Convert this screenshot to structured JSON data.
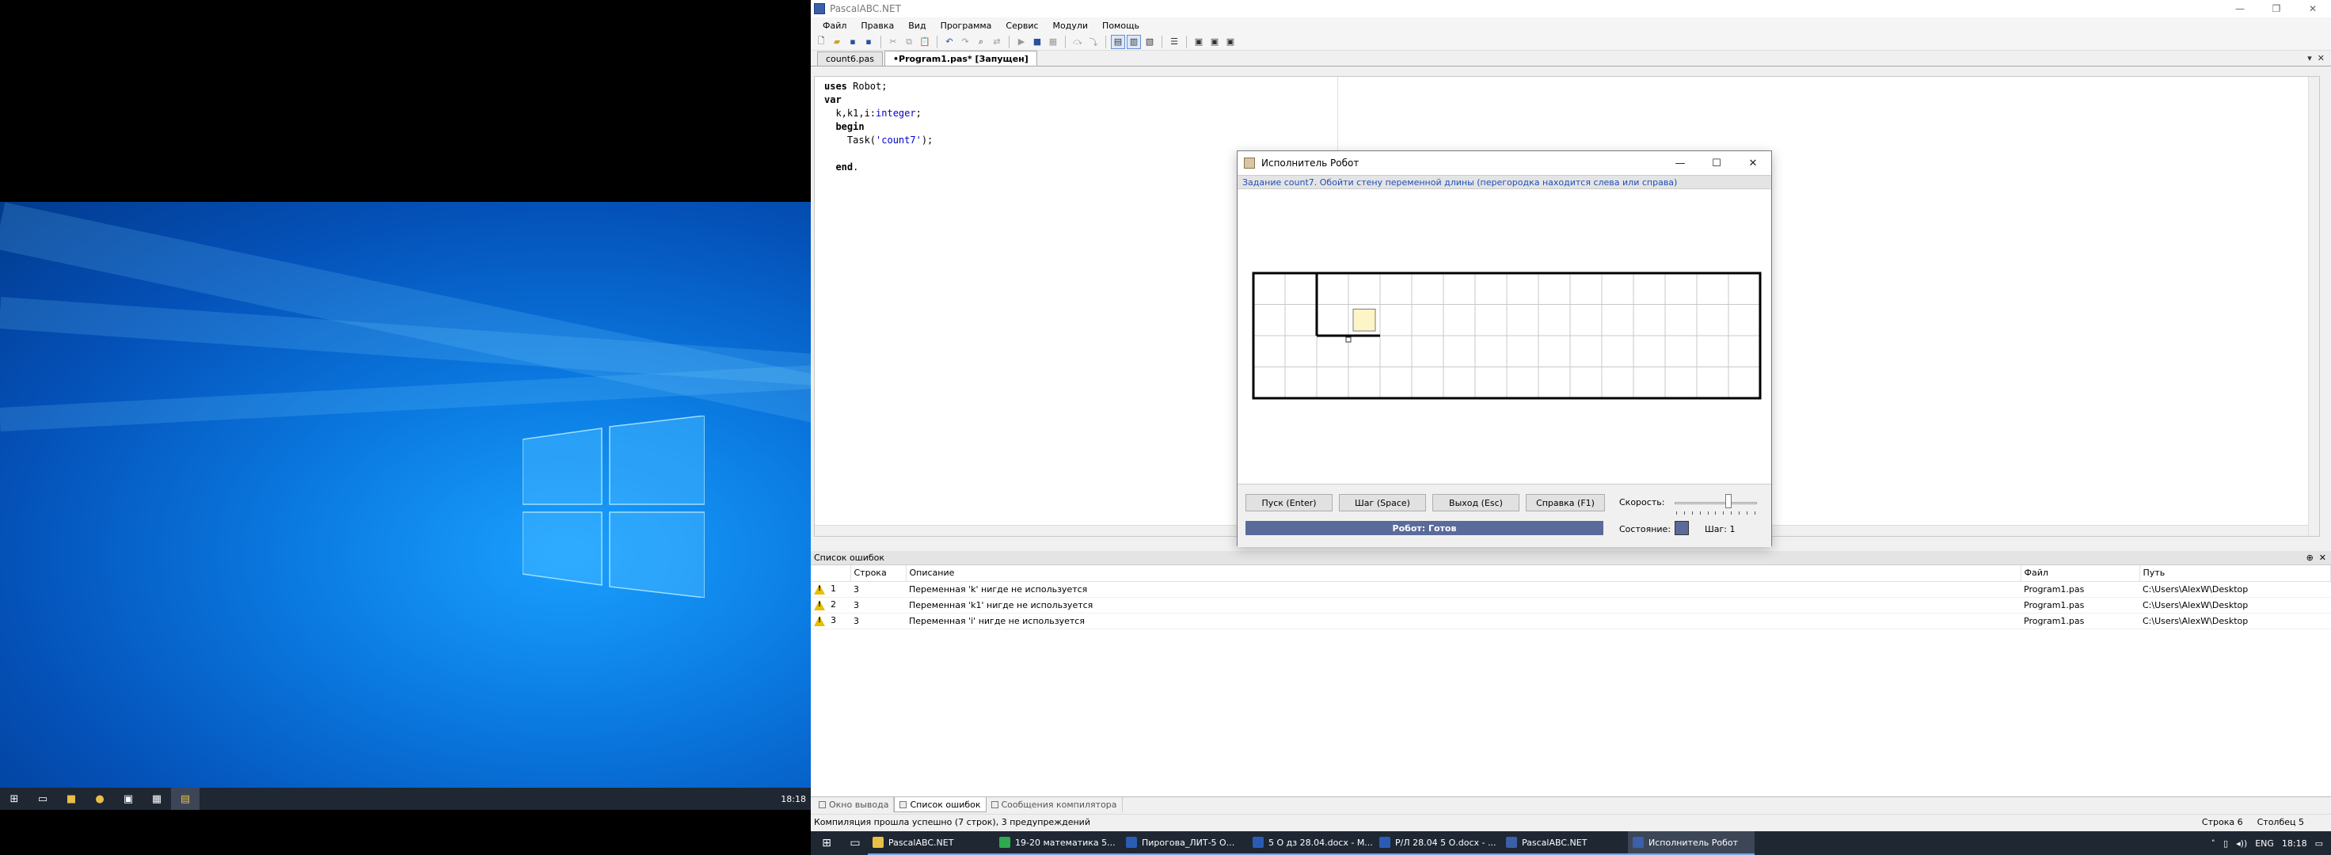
{
  "left_taskbar": {
    "time": "18:18"
  },
  "app": {
    "title": "PascalABC.NET",
    "menu": [
      "Файл",
      "Правка",
      "Вид",
      "Программа",
      "Сервис",
      "Модули",
      "Помощь"
    ],
    "doc_tabs": [
      {
        "label": "count6.pas",
        "active": false
      },
      {
        "label": "•Program1.pas* [Запущен]",
        "active": true
      }
    ],
    "code_lines": [
      "uses Robot;",
      "var",
      "  k,k1,i:integer;",
      "  begin",
      "    Task('count7');",
      "",
      "  end."
    ]
  },
  "robot": {
    "title": "Исполнитель Робот",
    "task": "Задание count7. Обойти стену переменной длины (перегородка находится слева или справа)",
    "buttons": {
      "run": "Пуск (Enter)",
      "step": "Шаг (Space)",
      "exit": "Выход (Esc)",
      "help": "Справка (F1)"
    },
    "status": "Робот: Готов",
    "speed_label": "Скорость:",
    "state_label": "Состояние:",
    "step_label": "Шаг: 1",
    "speed_fraction": 0.65,
    "grid": {
      "cols": 16,
      "rows": 4,
      "robot_col": 3,
      "robot_row": 1,
      "colors": {
        "wall": "#000000",
        "cell_line": "#c8c8c8",
        "robot_fill": "#fdf5c8",
        "robot_border": "#7a7a7a"
      }
    }
  },
  "errors": {
    "panel_title": "Список ошибок",
    "headers": {
      "n": "",
      "line": "Строка",
      "desc": "Описание",
      "file": "Файл",
      "path": "Путь"
    },
    "rows": [
      {
        "n": "1",
        "line": "3",
        "desc": "Переменная 'k' нигде не используется",
        "file": "Program1.pas",
        "path": "C:\\Users\\AlexW\\Desktop"
      },
      {
        "n": "2",
        "line": "3",
        "desc": "Переменная 'k1' нигде не используется",
        "file": "Program1.pas",
        "path": "C:\\Users\\AlexW\\Desktop"
      },
      {
        "n": "3",
        "line": "3",
        "desc": "Переменная 'i' нигде не используется",
        "file": "Program1.pas",
        "path": "C:\\Users\\AlexW\\Desktop"
      }
    ]
  },
  "bottom_tabs": [
    "Окно вывода",
    "Список ошибок",
    "Сообщения компилятора"
  ],
  "statusbar": {
    "message": "Компиляция прошла успешно (7 строк), 3 предупреждений",
    "row": "Строка 6",
    "col": "Столбец 5"
  },
  "taskbar": {
    "items": [
      {
        "label": "PascalABC.NET",
        "color": "#e8c048",
        "active": false
      },
      {
        "label": "19-20 математика 5...",
        "color": "#2fa84f",
        "active": false
      },
      {
        "label": "Пирогова_ЛИТ-5 О...",
        "color": "#2b5cb5",
        "active": false
      },
      {
        "label": "5 О дз 28.04.docx - M...",
        "color": "#2b5cb5",
        "active": false
      },
      {
        "label": "Р/Л 28.04 5 О.docx - ...",
        "color": "#2b5cb5",
        "active": false
      },
      {
        "label": "PascalABC.NET",
        "color": "#3b5fa8",
        "active": false
      },
      {
        "label": "Исполнитель Робот",
        "color": "#3b5fa8",
        "active": true
      }
    ],
    "lang": "ENG",
    "time": "18:18"
  }
}
